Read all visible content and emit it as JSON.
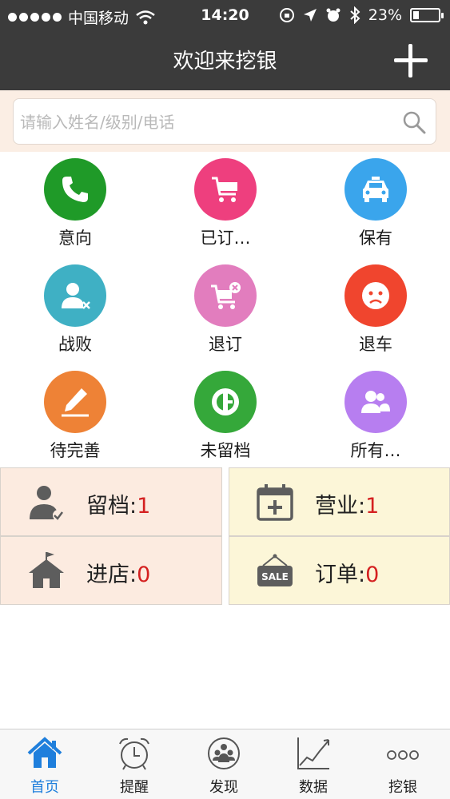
{
  "status_bar": {
    "carrier": "中国移动",
    "time": "14:20",
    "battery": "23%",
    "battery_level": 0.23
  },
  "nav": {
    "title": "欢迎来挖银",
    "add_icon": "plus-icon"
  },
  "search": {
    "placeholder": "请输入姓名/级别/电话",
    "value": "",
    "icon": "search-icon"
  },
  "grid": [
    {
      "label": "意向",
      "icon": "phone-icon",
      "color": "#1f9a28"
    },
    {
      "label": "已订…",
      "icon": "cart-icon",
      "color": "#ee3f7e"
    },
    {
      "label": "保有",
      "icon": "car-icon",
      "color": "#3aa5ec"
    },
    {
      "label": "战败",
      "icon": "user-remove-icon",
      "color": "#3fb0c4"
    },
    {
      "label": "退订",
      "icon": "cart-remove-icon",
      "color": "#e27dbe"
    },
    {
      "label": "退车",
      "icon": "sad-face-icon",
      "color": "#f0452e"
    },
    {
      "label": "待完善",
      "icon": "pencil-icon",
      "color": "#ee8236"
    },
    {
      "label": "未留档",
      "icon": "e-circle-icon",
      "color": "#35a83a"
    },
    {
      "label": "所有…",
      "icon": "group-icon",
      "color": "#b77ef0"
    }
  ],
  "stats": [
    {
      "label": "留档:",
      "value": "1",
      "icon": "user-check-icon",
      "bg": "#fcebe0"
    },
    {
      "label": "营业:",
      "value": "1",
      "icon": "calendar-plus-icon",
      "bg": "#fcf6d8"
    },
    {
      "label": "进店:",
      "value": "0",
      "icon": "house-flag-icon",
      "bg": "#fcebe0"
    },
    {
      "label": "订单:",
      "value": "0",
      "icon": "sale-sign-icon",
      "bg": "#fcf6d8"
    }
  ],
  "tabbar": [
    {
      "label": "首页",
      "icon": "home-icon",
      "active": true
    },
    {
      "label": "提醒",
      "icon": "alarm-clock-icon",
      "active": false
    },
    {
      "label": "发现",
      "icon": "people-circle-icon",
      "active": false
    },
    {
      "label": "数据",
      "icon": "line-chart-icon",
      "active": false
    },
    {
      "label": "挖银",
      "icon": "more-dots-icon",
      "active": false
    }
  ],
  "colors": {
    "navbar": "#3b3b3b",
    "accent": "#1f7fdc",
    "number": "#d42020"
  }
}
